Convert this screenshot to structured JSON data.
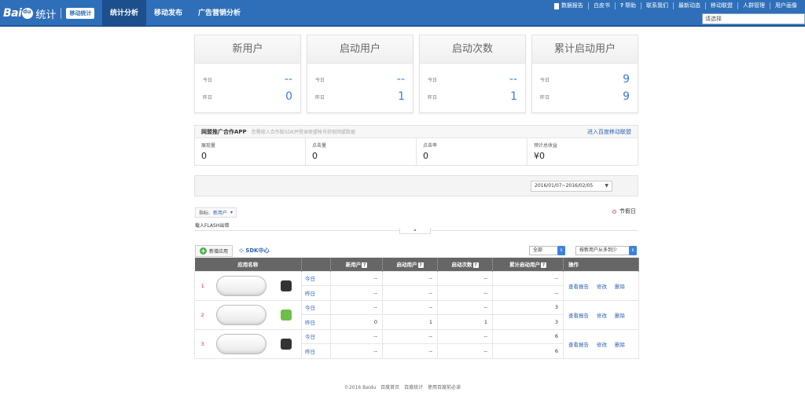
{
  "header": {
    "logo_bai": "Bai",
    "logo_tongji": "统计",
    "logo_badge": "移动统计",
    "nav": [
      "统计分析",
      "移动发布",
      "广告营销分析"
    ],
    "links": [
      "数据报告",
      "白皮书",
      "帮助",
      "联系我们",
      "最新动态",
      "移动联盟",
      "人群管理",
      "用户画像"
    ],
    "search_placeholder": "请选择"
  },
  "cards": [
    {
      "title": "新用户",
      "today_label": "今日",
      "today": "--",
      "yesterday_label": "昨日",
      "yesterday": "0"
    },
    {
      "title": "启动用户",
      "today_label": "今日",
      "today": "--",
      "yesterday_label": "昨日",
      "yesterday": "1"
    },
    {
      "title": "启动次数",
      "today_label": "今日",
      "today": "--",
      "yesterday_label": "昨日",
      "yesterday": "1"
    },
    {
      "title": "累计启动用户",
      "today_label": "今日",
      "today": "9",
      "yesterday_label": "昨日",
      "yesterday": "9"
    }
  ],
  "partner": {
    "title": "网盟推广合作APP",
    "desc": "您需接入合作版SDK并登录联盟帐号获取网盟数据",
    "link": "进入百度移动联盟",
    "cells": [
      {
        "label": "展现量",
        "value": "0"
      },
      {
        "label": "点击量",
        "value": "0"
      },
      {
        "label": "点击率",
        "value": "0"
      },
      {
        "label": "预计总收益",
        "value": "¥0"
      }
    ]
  },
  "date_range": "2016/01/07~2016/02/05",
  "metric": {
    "label": "指标:",
    "value": "新用户"
  },
  "holiday_label": "节假日",
  "flash_text": "载入FLASH出错",
  "toolbar": {
    "add_app": "新增应用",
    "sdk_center": "SDK中心",
    "filter_all": "全部",
    "sort_by": "按新用户从多到少"
  },
  "table": {
    "headers": [
      "应用名称",
      "新用户",
      "启动用户",
      "启动次数",
      "累计启动用户",
      "操作"
    ],
    "ops": [
      "查看报告",
      "修改",
      "删除"
    ],
    "rows": [
      {
        "rank": "1",
        "platform": "ios",
        "today": [
          "今日",
          "--",
          "--",
          "--",
          "--"
        ],
        "yesterday": [
          "昨日",
          "--",
          "--",
          "--",
          "--"
        ]
      },
      {
        "rank": "2",
        "platform": "android",
        "today": [
          "今日",
          "--",
          "--",
          "--",
          "3"
        ],
        "yesterday": [
          "昨日",
          "0",
          "1",
          "1",
          "3"
        ]
      },
      {
        "rank": "3",
        "platform": "ios",
        "today": [
          "今日",
          "--",
          "--",
          "--",
          "6"
        ],
        "yesterday": [
          "昨日",
          "--",
          "--",
          "--",
          "6"
        ]
      }
    ]
  },
  "footer": [
    "©2016 Baidu",
    "百度首页",
    "百度统计",
    "使用百度前必读"
  ],
  "colors": {
    "header_bg": "#2f6fb9",
    "link": "#2b62b4",
    "value": "#3b7dd8",
    "table_head": "#666666",
    "rank": "#e23333"
  }
}
